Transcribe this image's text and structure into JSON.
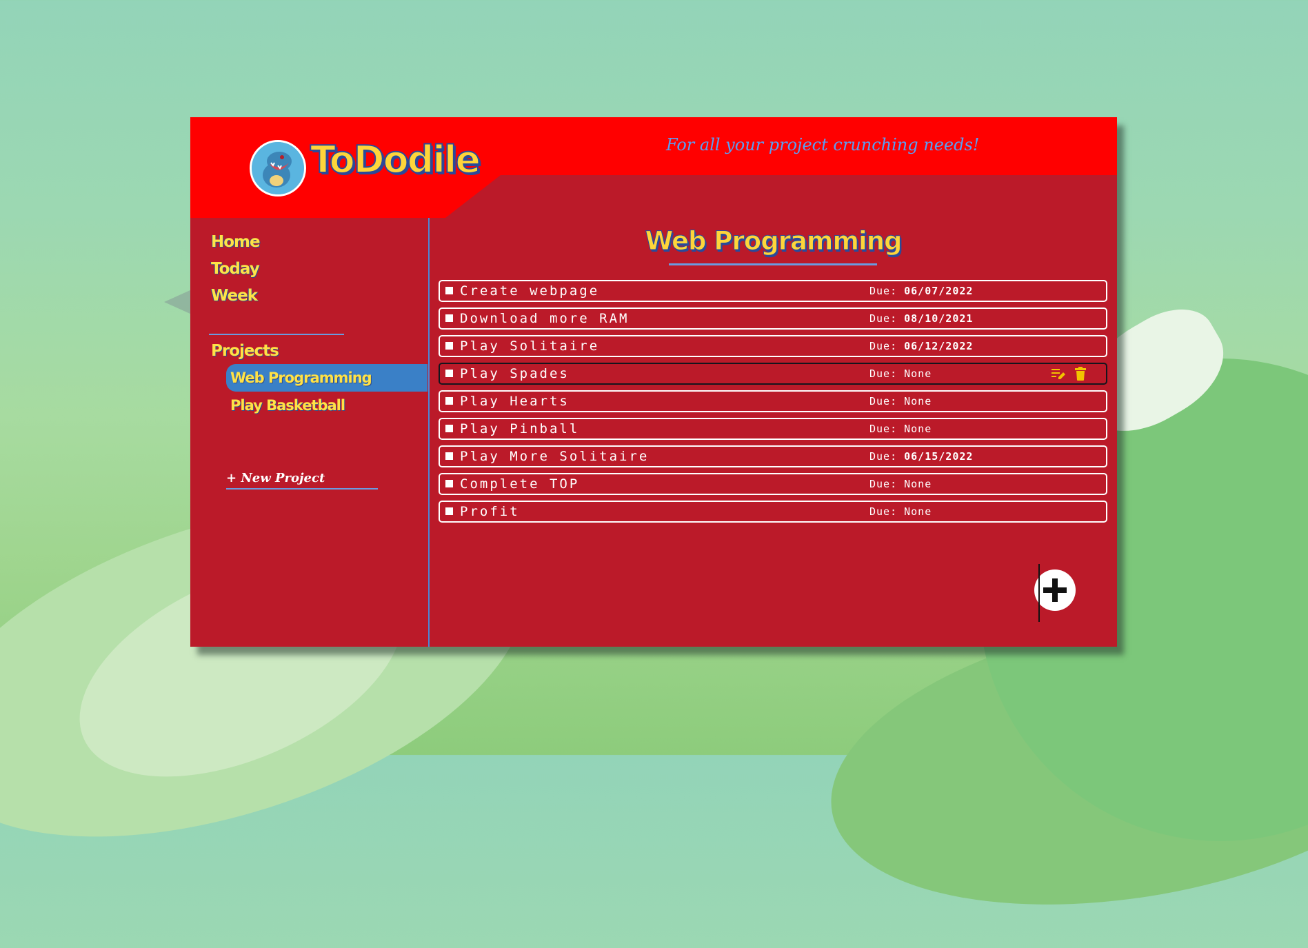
{
  "app": {
    "title": "ToDodile",
    "tagline": "For all your project crunching needs!"
  },
  "sidebar": {
    "nav": [
      {
        "label": "Home"
      },
      {
        "label": "Today"
      },
      {
        "label": "Week"
      }
    ],
    "projects_label": "Projects",
    "projects": [
      {
        "label": "Web Programming",
        "active": true
      },
      {
        "label": "Play Basketball",
        "active": false
      }
    ],
    "new_project_label": "+ New Project"
  },
  "main": {
    "title": "Web Programming",
    "due_label": "Due:",
    "tasks": [
      {
        "title": "Create webpage",
        "due": "06/07/2022"
      },
      {
        "title": "Download more RAM",
        "due": "08/10/2021"
      },
      {
        "title": "Play Solitaire",
        "due": "06/12/2022"
      },
      {
        "title": "Play Spades",
        "due": "None"
      },
      {
        "title": "Play Hearts",
        "due": "None"
      },
      {
        "title": "Play Pinball",
        "due": "None"
      },
      {
        "title": "Play More Solitaire",
        "due": "06/15/2022"
      },
      {
        "title": "Complete TOP",
        "due": "None"
      },
      {
        "title": "Profit",
        "due": "None"
      }
    ]
  },
  "icons": {
    "logo": "totodile-avatar-icon",
    "edit": "edit-task-icon",
    "delete": "trash-icon",
    "add": "plus-icon"
  },
  "colors": {
    "app_background": "#bb1a29",
    "header_red": "#ff0000",
    "accent_yellow": "#ffd53a",
    "accent_blue": "#3a80c7",
    "tagline_blue": "#5b9ef3",
    "icon_yellow": "#f2c400"
  }
}
